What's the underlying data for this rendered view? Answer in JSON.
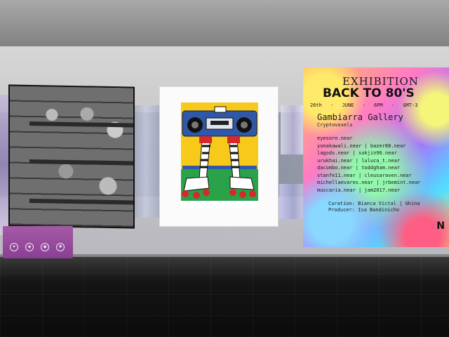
{
  "poster": {
    "title": "EXHIBITION",
    "headline": "BACK TO 80'S",
    "date_parts": [
      "26th",
      "-",
      "JUNE",
      "-",
      "6PM",
      "-",
      "GMT-3"
    ],
    "gallery": "Gambiarra Gallery",
    "venue": "Cryptovoxels",
    "artists": [
      "eyesore.near",
      "yonakawali.near | bazer88.near",
      "lagods.near | sukjin96.near",
      "urukhai.near | luluca_t.near",
      "dacombo.near | toddgham.near",
      "stanfe11.near | cleusaraven.near",
      "michellaevares.near | jrbemint.near",
      "muscaria.near | jam2017.near"
    ],
    "curation_lines": [
      "Curation: Bianca Victal | Ghina",
      "Producer: Isa Bandinicho"
    ],
    "logo": "N"
  },
  "colors": {
    "sign_purple": "#9a4c9e",
    "boombox_blue": "#3058a8",
    "skate_red": "#d32a2a",
    "poster_yellow": "#ffe44a"
  }
}
